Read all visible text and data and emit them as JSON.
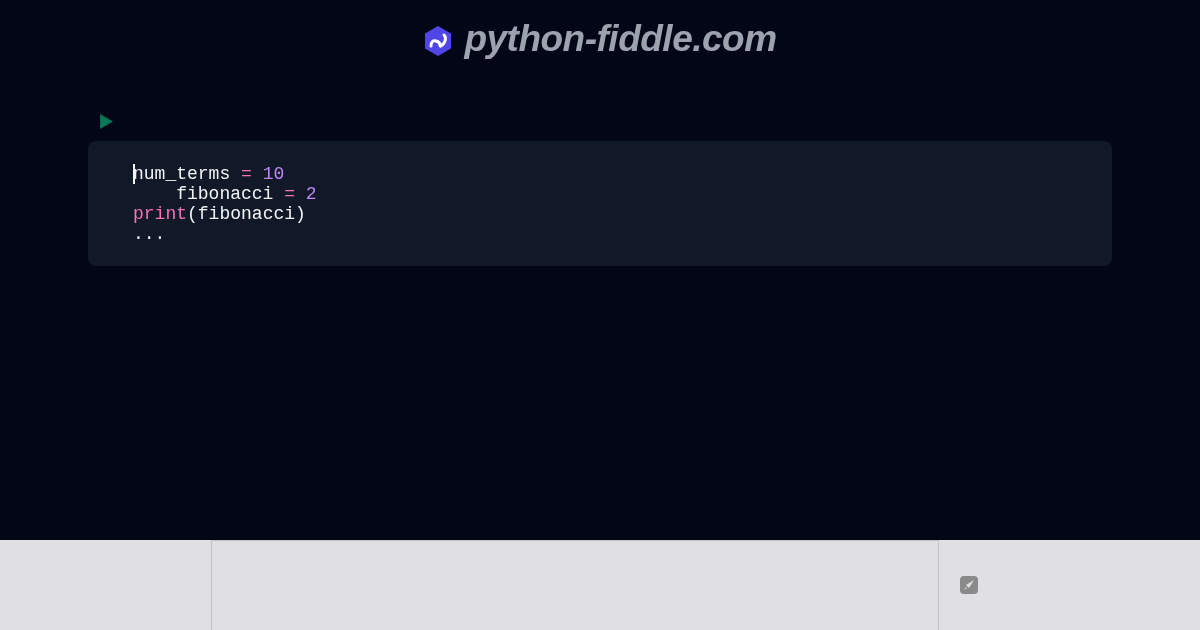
{
  "header": {
    "site_name": "python-fiddle.com"
  },
  "code": {
    "lines": [
      {
        "cursor": true,
        "tokens": [
          {
            "text": "num_terms ",
            "kind": "plain"
          },
          {
            "text": "= ",
            "kind": "operator"
          },
          {
            "text": "10",
            "kind": "number"
          }
        ]
      },
      {
        "cursor": false,
        "tokens": [
          {
            "text": "    fibonacci ",
            "kind": "plain"
          },
          {
            "text": "= ",
            "kind": "operator"
          },
          {
            "text": "2",
            "kind": "number"
          }
        ]
      },
      {
        "cursor": false,
        "tokens": [
          {
            "text": "print",
            "kind": "builtin"
          },
          {
            "text": "(fibonacci)",
            "kind": "plain"
          }
        ]
      },
      {
        "cursor": false,
        "tokens": [
          {
            "text": "...",
            "kind": "plain"
          }
        ]
      }
    ]
  }
}
